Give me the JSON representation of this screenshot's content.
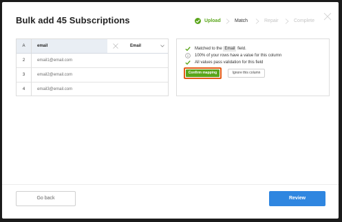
{
  "modal": {
    "title": "Bulk add 45 Subscriptions"
  },
  "steps": [
    {
      "label": "Upload",
      "state": "complete"
    },
    {
      "label": "Match",
      "state": "current"
    },
    {
      "label": "Repair",
      "state": "future"
    },
    {
      "label": "Complete",
      "state": "future"
    }
  ],
  "table": {
    "header": {
      "index": "A",
      "column": "email"
    },
    "mapping": {
      "field": "Email"
    },
    "rows": [
      {
        "index": "2",
        "value": "email1@email.com"
      },
      {
        "index": "3",
        "value": "email2@email.com"
      },
      {
        "index": "4",
        "value": "email3@email.com"
      }
    ]
  },
  "panel": {
    "matched_prefix": "Matched to the",
    "matched_field": "Email",
    "matched_suffix": "field.",
    "rows_value": "100% of your rows have a value for this column",
    "validation": "All values pass validation for this field",
    "confirm_label": "Confirm mapping",
    "ignore_label": "Ignore this column"
  },
  "footer": {
    "back_label": "Go back",
    "review_label": "Review"
  },
  "colors": {
    "accent_green": "#5aa51a",
    "primary_blue": "#2f86e0",
    "highlight_orange": "#e35a14"
  },
  "icons": {
    "close": "close-icon",
    "step_complete": "check-circle-icon",
    "step_separator": "chevron-right-icon",
    "unmatched": "x-icon",
    "dropdown": "caret-down-icon",
    "check": "check-icon",
    "info": "info-circle-icon"
  }
}
